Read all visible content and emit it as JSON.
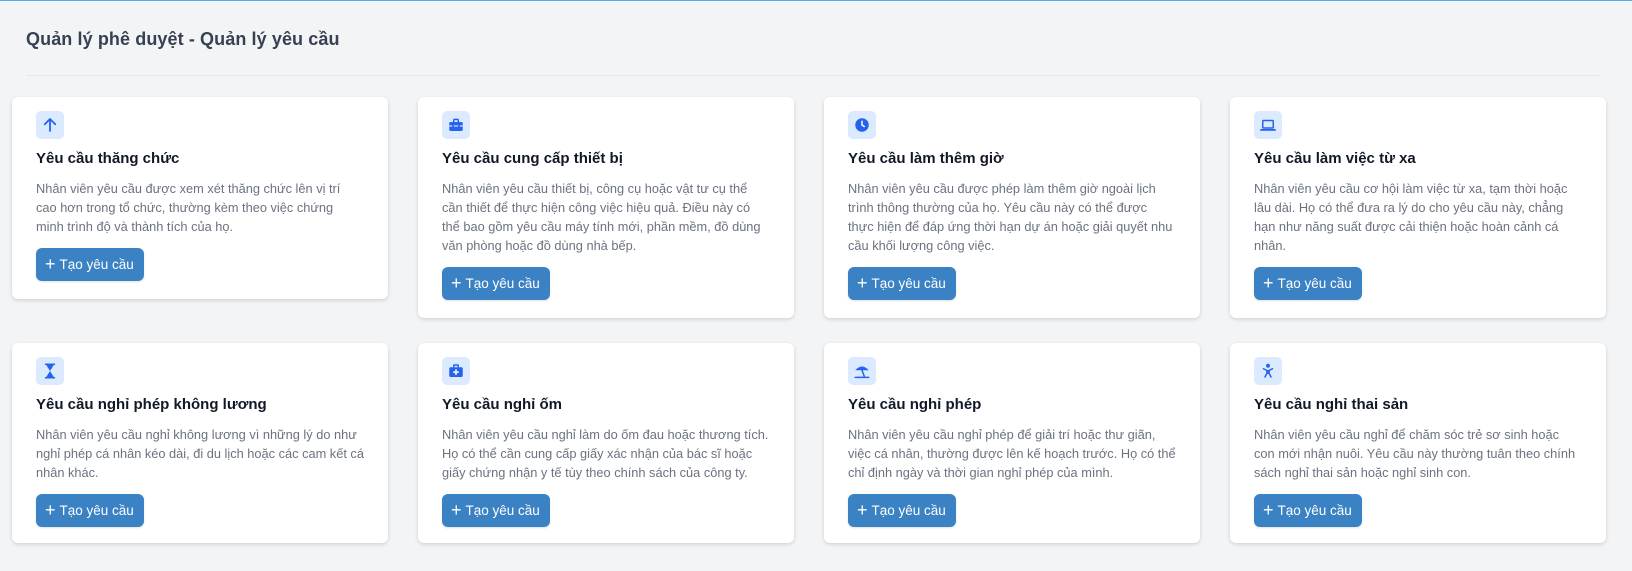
{
  "page": {
    "title": "Quản lý phê duyệt - Quản lý yêu cầu"
  },
  "colors": {
    "accent": "#3b82c4",
    "icon_bg": "#dbeafe",
    "icon_fg": "#2563eb"
  },
  "cards": [
    {
      "icon": "arrow-up-icon",
      "title": "Yêu cầu thăng chức",
      "description": "Nhân viên yêu cầu được xem xét thăng chức lên vị trí cao hơn trong tổ chức, thường kèm theo việc chứng minh trình độ và thành tích của họ.",
      "button_label": "Tạo yêu cầu"
    },
    {
      "icon": "toolbox-icon",
      "title": "Yêu cầu cung cấp thiết bị",
      "description": "Nhân viên yêu cầu thiết bị, công cụ hoặc vật tư cụ thể cần thiết để thực hiện công việc hiệu quả. Điều này có thể bao gồm yêu cầu máy tính mới, phần mềm, đồ dùng văn phòng hoặc đồ dùng nhà bếp.",
      "button_label": "Tạo yêu cầu"
    },
    {
      "icon": "clock-icon",
      "title": "Yêu cầu làm thêm giờ",
      "description": "Nhân viên yêu cầu được phép làm thêm giờ ngoài lịch trình thông thường của họ. Yêu cầu này có thể được thực hiện để đáp ứng thời hạn dự án hoặc giải quyết nhu cầu khối lượng công việc.",
      "button_label": "Tạo yêu cầu"
    },
    {
      "icon": "laptop-icon",
      "title": "Yêu cầu làm việc từ xa",
      "description": "Nhân viên yêu cầu cơ hội làm việc từ xa, tạm thời hoặc lâu dài. Họ có thể đưa ra lý do cho yêu cầu này, chẳng hạn như năng suất được cải thiện hoặc hoàn cảnh cá nhân.",
      "button_label": "Tạo yêu cầu"
    },
    {
      "icon": "hourglass-icon",
      "title": "Yêu cầu nghỉ phép không lương",
      "description": "Nhân viên yêu cầu nghỉ không lương vì những lý do như nghỉ phép cá nhân kéo dài, đi du lịch hoặc các cam kết cá nhân khác.",
      "button_label": "Tạo yêu cầu"
    },
    {
      "icon": "medical-kit-icon",
      "title": "Yêu cầu nghỉ ốm",
      "description": "Nhân viên yêu cầu nghỉ làm do ốm đau hoặc thương tích. Họ có thể cần cung cấp giấy xác nhận của bác sĩ hoặc giấy chứng nhận y tế tùy theo chính sách của công ty.",
      "button_label": "Tạo yêu cầu"
    },
    {
      "icon": "beach-umbrella-icon",
      "title": "Yêu cầu nghỉ phép",
      "description": "Nhân viên yêu cầu nghỉ phép để giải trí hoặc thư giãn, việc cá nhân, thường được lên kế hoạch trước. Họ có thể chỉ định ngày và thời gian nghỉ phép của mình.",
      "button_label": "Tạo yêu cầu"
    },
    {
      "icon": "baby-icon",
      "title": "Yêu cầu nghỉ thai sản",
      "description": "Nhân viên yêu cầu nghỉ để chăm sóc trẻ sơ sinh hoặc con mới nhận nuôi. Yêu cầu này thường tuân theo chính sách nghỉ thai sản hoặc nghỉ sinh con.",
      "button_label": "Tạo yêu cầu"
    }
  ]
}
